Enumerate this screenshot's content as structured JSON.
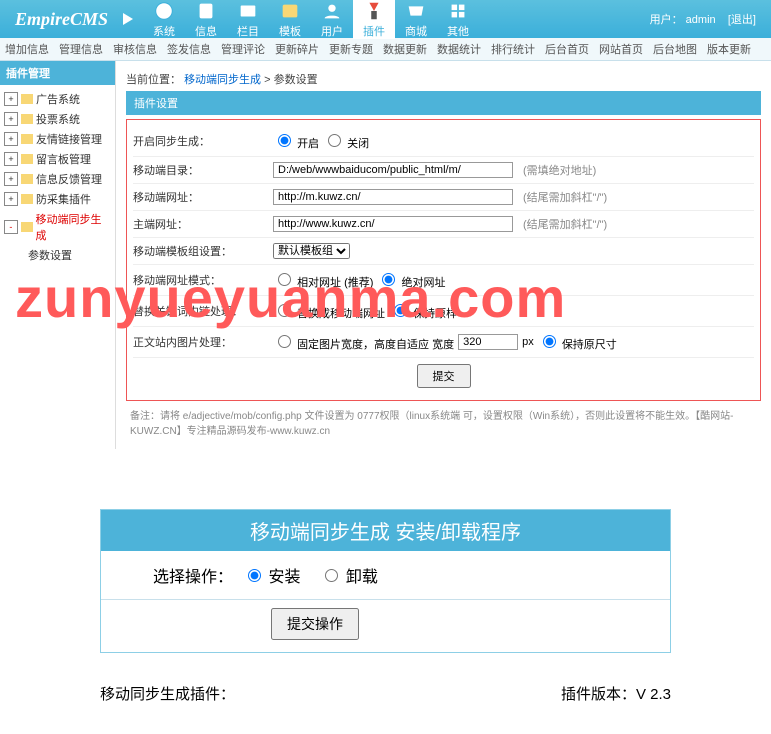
{
  "header": {
    "logo": "EmpireCMS",
    "user_label": "用户：",
    "user_name": "admin",
    "logout": "[退出]"
  },
  "topmenu": [
    {
      "label": "系统"
    },
    {
      "label": "信息"
    },
    {
      "label": "栏目"
    },
    {
      "label": "模板"
    },
    {
      "label": "用户"
    },
    {
      "label": "插件",
      "active": true
    },
    {
      "label": "商城"
    },
    {
      "label": "其他"
    }
  ],
  "subnav": [
    "增加信息",
    "管理信息",
    "审核信息",
    "签发信息",
    "管理评论",
    "更新碎片",
    "更新专题",
    "数据更新",
    "数据统计",
    "排行统计",
    "后台首页",
    "网站首页",
    "后台地图",
    "版本更新"
  ],
  "sidebar": {
    "title": "插件管理",
    "items": [
      {
        "label": "广告系统"
      },
      {
        "label": "投票系统"
      },
      {
        "label": "友情链接管理"
      },
      {
        "label": "留言板管理"
      },
      {
        "label": "信息反馈管理"
      },
      {
        "label": "防采集插件"
      },
      {
        "label": "移动端同步生成",
        "open": true,
        "children": [
          {
            "label": "参数设置"
          }
        ]
      }
    ]
  },
  "breadcrumb": {
    "prefix": "当前位置：",
    "path": "移动端同步生成",
    "sep": " > ",
    "leaf": "参数设置"
  },
  "panel_title": "插件设置",
  "form": {
    "row1": {
      "label": "开启同步生成：",
      "opt1": "开启",
      "opt2": "关闭"
    },
    "row2": {
      "label": "移动端目录：",
      "value": "D:/web/wwwbaiducom/public_html/m/",
      "hint": "(需填绝对地址)"
    },
    "row3": {
      "label": "移动端网址：",
      "value": "http://m.kuwz.cn/",
      "hint": "(结尾需加斜杠\"/\")"
    },
    "row4": {
      "label": "主端网址：",
      "value": "http://www.kuwz.cn/",
      "hint": "(结尾需加斜杠\"/\")"
    },
    "row5": {
      "label": "移动端模板组设置：",
      "value": "默认模板组"
    },
    "row6": {
      "label": "移动端网址模式：",
      "opt1": "相对网址 (推荐)",
      "opt2": "绝对网址"
    },
    "row7": {
      "label": "替换关键词内链处理：",
      "opt1": "替换成移动端网址",
      "opt2": "保持原样"
    },
    "row8": {
      "label": "正文站内图片处理：",
      "opt1": "固定图片宽度，高度自适应 宽度",
      "px": "320",
      "unit": "px",
      "opt2": "保持原尺寸"
    },
    "submit": "提交"
  },
  "footer_note": "备注：请将 e/adjective/mob/config.php 文件设置为 0777权限（linux系统端 可，设置权限（Win系统），否则此设置将不能生效。【酷网站-KUWZ.CN】专注精品源码发布-www.kuwz.cn",
  "watermark": "zunyueyuanma.com",
  "install": {
    "title": "移动端同步生成  安装/卸载程序",
    "label": "选择操作：",
    "opt1": "安装",
    "opt2": "卸载",
    "submit": "提交操作"
  },
  "bottom": {
    "left": "移动同步生成插件：",
    "right": "插件版本：V 2.3"
  }
}
